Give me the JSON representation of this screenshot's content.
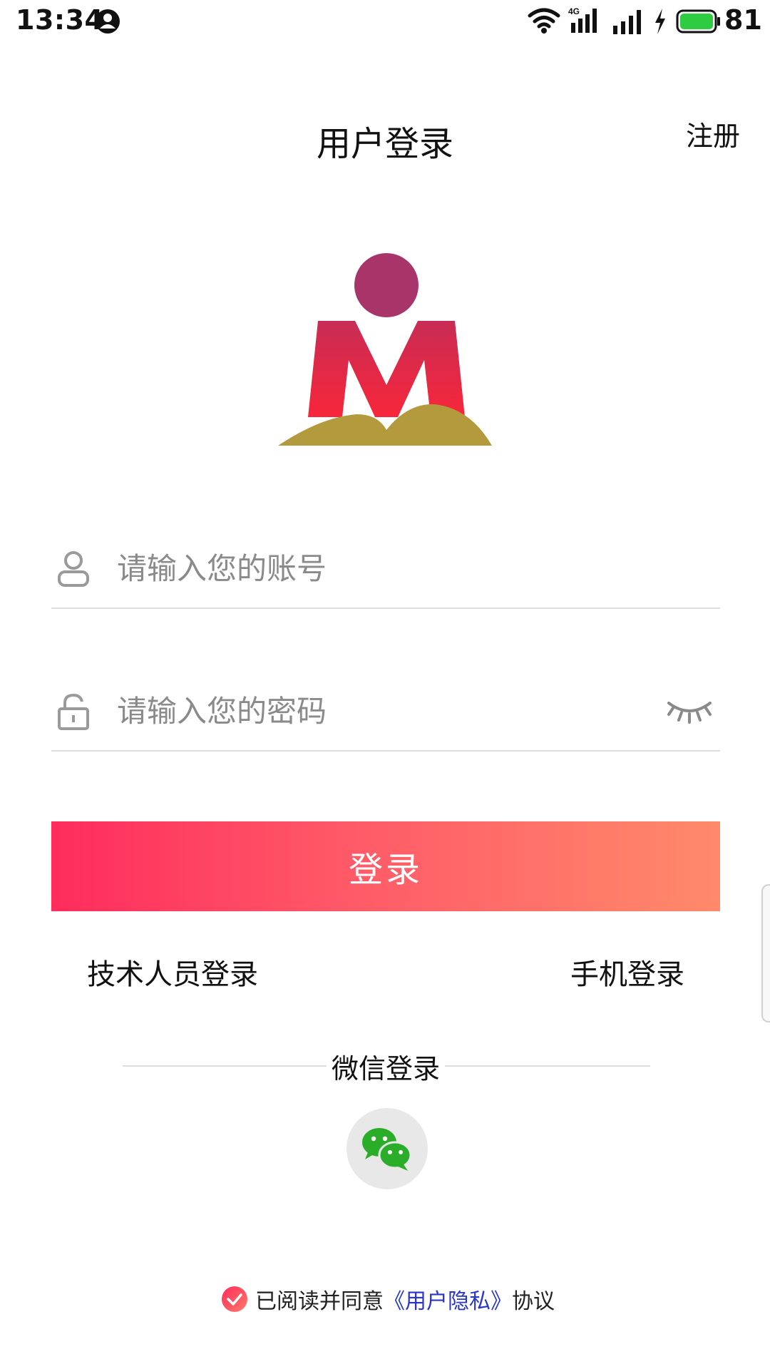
{
  "status_bar": {
    "time": "13:34",
    "network_label": "4G",
    "battery_level": "81",
    "icons": [
      "user-icon",
      "wifi-icon",
      "4g-signal-icon",
      "signal-icon",
      "charging-icon",
      "battery-icon"
    ],
    "battery_color": "#2ecc40"
  },
  "header": {
    "title": "用户登录",
    "register_label": "注册"
  },
  "logo": {
    "icon": "m-logo",
    "colors": {
      "circle": "#a8346a",
      "letter_top": "#d22a52",
      "letter_bottom": "#f3283e",
      "hill": "#b39a3c"
    }
  },
  "form": {
    "account": {
      "placeholder": "请输入您的账号",
      "value": "",
      "icon": "user-outline-icon"
    },
    "password": {
      "placeholder": "请输入您的密码",
      "value": "",
      "icon": "lock-icon",
      "toggle_icon": "eye-closed-icon"
    },
    "login_button_label": "登录",
    "button_gradient": [
      "#ff2c5c",
      "#ff8a6a"
    ]
  },
  "alt_login": {
    "technician_label": "技术人员登录",
    "phone_label": "手机登录"
  },
  "wechat": {
    "divider_title": "微信登录",
    "icon": "wechat-icon",
    "brand_color": "#2aae2a"
  },
  "agreement": {
    "checked": true,
    "prefix": "已阅读并同意",
    "link": "《用户隐私》",
    "suffix": "协议",
    "link_color": "#2a36c9"
  }
}
